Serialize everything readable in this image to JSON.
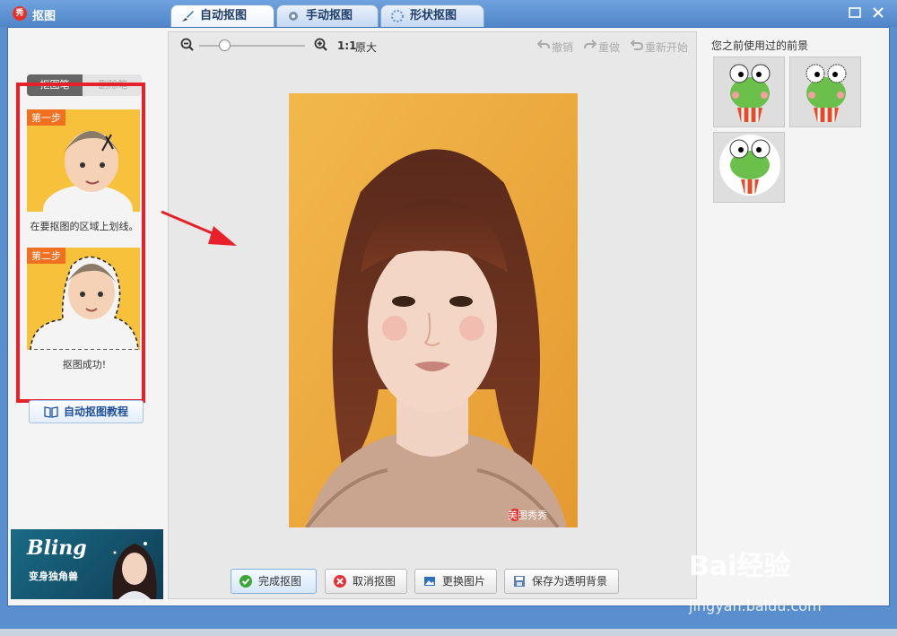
{
  "window": {
    "title": "抠图",
    "logo_char": "秀"
  },
  "tabs": [
    {
      "label": "自动抠图",
      "active": true,
      "icon": "brush-icon"
    },
    {
      "label": "手动抠图",
      "active": false,
      "icon": "gear-icon"
    },
    {
      "label": "形状抠图",
      "active": false,
      "icon": "shape-icon"
    }
  ],
  "left": {
    "mode_on": "抠图笔",
    "mode_off": "删除笔",
    "step1_tag": "第一步",
    "step1_caption": "在要抠图的区域上划线。",
    "step2_tag": "第二步",
    "step2_caption": "抠图成功!",
    "tutorial_button": "自动抠图教程",
    "ad_title": "Bling",
    "ad_subtitle": "变身独角兽"
  },
  "toolbar": {
    "zoom_ratio": "1:1",
    "original_size": "原大",
    "undo": "撤销",
    "redo": "重做",
    "restart": "重新开始"
  },
  "photo_watermark": "美图秀秀",
  "bottom_buttons": {
    "finish": "完成抠图",
    "cancel": "取消抠图",
    "replace": "更换图片",
    "save_transparent": "保存为透明背景"
  },
  "right": {
    "title": "您之前使用过的前景"
  },
  "overlay": {
    "baidu": "Bai经验",
    "baidu_url": "jingyan.baidu.com"
  },
  "colors": {
    "accent": "#4f86c8",
    "highlight_red": "#e8202a",
    "photo_bg": "#f0b24a"
  }
}
